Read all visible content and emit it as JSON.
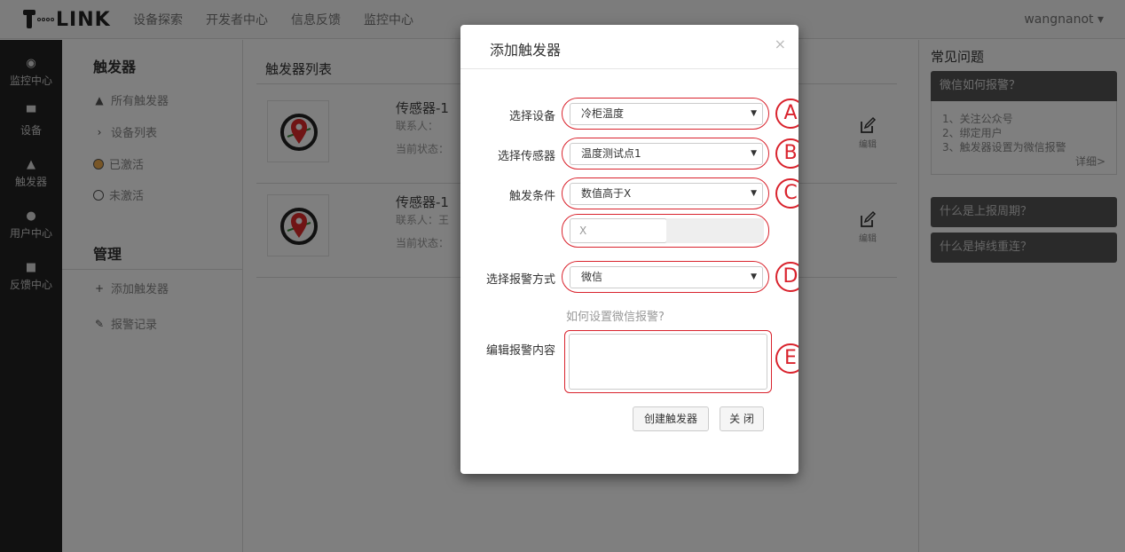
{
  "nav": {
    "brand": "LINK",
    "links": [
      "设备探索",
      "开发者中心",
      "信息反馈",
      "监控中心"
    ],
    "user": "wangnanot ▾"
  },
  "darkbar": {
    "items": [
      {
        "icon": "target-icon",
        "label": "监控中心"
      },
      {
        "icon": "monitor-icon",
        "label": "设备"
      },
      {
        "icon": "bell-icon",
        "label": "触发器"
      },
      {
        "icon": "user-icon",
        "label": "用户中心"
      },
      {
        "icon": "comment-icon",
        "label": "反馈中心"
      }
    ]
  },
  "subbar": {
    "title1": "触发器",
    "items1": [
      "所有触发器",
      "设备列表",
      "已激活",
      "未激活"
    ],
    "title2": "管理",
    "items2": [
      "添加触发器",
      "报警记录"
    ]
  },
  "main": {
    "heading": "触发器列表",
    "cards": [
      {
        "name": "传感器-1",
        "contact": "联系人：",
        "state": "当前状态：",
        "edit": "编辑"
      },
      {
        "name": "传感器-1",
        "contact": "联系人：王",
        "state": "当前状态：",
        "edit": "编辑"
      }
    ]
  },
  "faq": {
    "heading": "常见问题",
    "q1": "微信如何报警？",
    "a1": [
      "1、关注公众号",
      "2、绑定用户",
      "3、触发器设置为微信报警"
    ],
    "more": "详细>",
    "q2": "什么是上报周期？",
    "q3": "什么是掉线重连？"
  },
  "modal": {
    "title": "添加触发器",
    "close": "×",
    "device_label": "选择设备",
    "device_value": "冷柜温度",
    "sensor_label": "选择传感器",
    "sensor_value": "温度测试点1",
    "cond_label": "触发条件",
    "cond_value": "数值高于X",
    "x_placeholder": "X",
    "alarm_label": "选择报警方式",
    "alarm_value": "微信",
    "help_link": "如何设置微信报警?",
    "content_label": "编辑报警内容",
    "create_btn": "创建触发器",
    "close_btn": "关 闭",
    "markers": [
      "A",
      "B",
      "C",
      "D",
      "E"
    ]
  },
  "colors": {
    "accent_red": "#d9232d",
    "overlay": "rgba(0,0,0,0.5)",
    "sidebar_dark": "#222222"
  }
}
